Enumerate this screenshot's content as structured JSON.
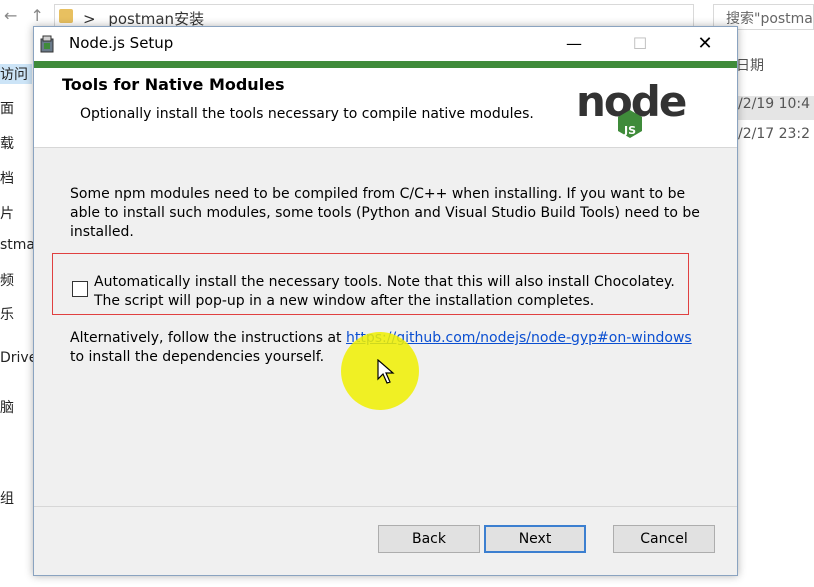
{
  "explorer": {
    "path_separator": ">",
    "path": "postman安装",
    "search_placeholder": "搜索\"postman",
    "nav_items": [
      "访问",
      "面",
      "载",
      "档",
      "片",
      "stma",
      "频",
      "乐",
      "Drive",
      "脑",
      "组"
    ],
    "column_header": "日期",
    "rows": [
      "/2/19 10:4",
      "/2/17 23:2"
    ]
  },
  "window": {
    "title": "Node.js Setup",
    "minimize": "—",
    "maximize": "☐",
    "close": "✕"
  },
  "header": {
    "title": "Tools for Native Modules",
    "subtitle": "Optionally install the tools necessary to compile native modules.",
    "logo_text": "node",
    "logo_sub": "JS"
  },
  "content": {
    "intro": "Some npm modules need to be compiled from C/C++ when installing. If you want to be able to install such modules, some tools (Python and Visual Studio Build Tools) need to be installed.",
    "checkbox_label": "Automatically install the necessary tools. Note that this will also install Chocolatey. The script will pop-up in a new window after the installation completes.",
    "checkbox_checked": false,
    "alt_prefix": "Alternatively, follow the instructions at ",
    "alt_link": "https://github.com/nodejs/node-gyp#on-windows",
    "alt_suffix": "to install the dependencies yourself."
  },
  "buttons": {
    "back": "Back",
    "next": "Next",
    "cancel": "Cancel"
  },
  "colors": {
    "accent": "#3f8b3a",
    "link": "#0b4fd1",
    "highlight_box": "#e04040"
  }
}
